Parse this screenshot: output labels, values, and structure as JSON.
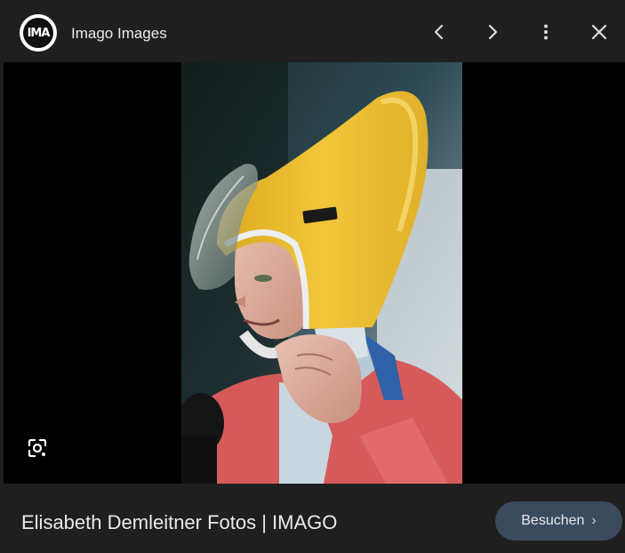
{
  "header": {
    "logo_text": "IMA",
    "source_name": "Imago Images",
    "buttons": {
      "previous_icon": "chevron-left-icon",
      "next_icon": "chevron-right-icon",
      "more_icon": "more-vertical-icon",
      "close_icon": "close-icon"
    }
  },
  "viewer": {
    "lens_icon": "google-lens-icon"
  },
  "footer": {
    "caption": "Elisabeth Demleitner Fotos | IMAGO",
    "visit_label": "Besuchen",
    "visit_chevron": "›"
  },
  "colors": {
    "background": "#1f1f1f",
    "image_backdrop": "#000000",
    "button_bg": "#3c4a5e",
    "text": "#e8eaed"
  }
}
